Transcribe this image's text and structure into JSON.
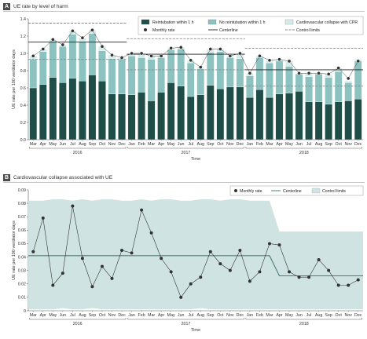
{
  "panels": {
    "a": {
      "letter": "A",
      "title": "UE rate by level of harm"
    },
    "b": {
      "letter": "B",
      "title": "Cardiovascular collapse associated with UE"
    }
  },
  "chart_data": [
    {
      "type": "bar",
      "stacked": true,
      "title": "UE rate by level of harm",
      "xlabel": "Time",
      "ylabel": "UE rate per 100 ventilator days",
      "ylim": [
        0,
        1.4
      ],
      "yticks": [
        0,
        0.2,
        0.4,
        0.6,
        0.8,
        1.0,
        1.2,
        1.4
      ],
      "grid": false,
      "legend_position": "top-right",
      "categories": [
        "Mar",
        "Apr",
        "May",
        "Jun",
        "Jul",
        "Aug",
        "Sep",
        "Oct",
        "Nov",
        "Dec",
        "Jan",
        "Feb",
        "Mar",
        "Apr",
        "May",
        "Jun",
        "Jul",
        "Aug",
        "Sep",
        "Oct",
        "Nov",
        "Dec",
        "Jan",
        "Feb",
        "Mar",
        "Apr",
        "May",
        "Jun",
        "Jul",
        "Aug",
        "Sep",
        "Oct",
        "Nov",
        "Dec"
      ],
      "year_groups": [
        {
          "label": "2016",
          "start": 0,
          "end": 9
        },
        {
          "label": "2017",
          "start": 10,
          "end": 21
        },
        {
          "label": "2018",
          "start": 22,
          "end": 33
        }
      ],
      "series": [
        {
          "name": "Reintubation within 1 h",
          "color": "#1f4d47",
          "values": [
            0.6,
            0.64,
            0.72,
            0.66,
            0.71,
            0.68,
            0.75,
            0.68,
            0.53,
            0.53,
            0.52,
            0.55,
            0.45,
            0.55,
            0.66,
            0.62,
            0.5,
            0.52,
            0.63,
            0.59,
            0.61,
            0.61,
            0.49,
            0.58,
            0.49,
            0.53,
            0.54,
            0.56,
            0.44,
            0.44,
            0.41,
            0.44,
            0.45,
            0.47
          ]
        },
        {
          "name": "No reintubation within 1 h",
          "color": "#8cc3c1",
          "values": [
            0.33,
            0.38,
            0.42,
            0.42,
            0.51,
            0.46,
            0.48,
            0.35,
            0.41,
            0.4,
            0.45,
            0.4,
            0.48,
            0.4,
            0.38,
            0.43,
            0.39,
            0.3,
            0.38,
            0.43,
            0.34,
            0.33,
            0.25,
            0.37,
            0.4,
            0.38,
            0.31,
            0.2,
            0.29,
            0.32,
            0.31,
            0.35,
            0.21,
            0.44
          ]
        },
        {
          "name": "Cardiovascular collapse with CPR",
          "color": "#d7ebeb",
          "values": [
            0.04,
            0.03,
            0.02,
            0.02,
            0.04,
            0.04,
            0.04,
            0.05,
            0.04,
            0.02,
            0.03,
            0.05,
            0.04,
            0.02,
            0.02,
            0.02,
            0.03,
            0.02,
            0.04,
            0.03,
            0.02,
            0.06,
            0.03,
            0.02,
            0.03,
            0.02,
            0.06,
            0.01,
            0.04,
            0.01,
            0.04,
            0.04,
            0.02,
            0.02
          ]
        }
      ],
      "monthly_rate": {
        "name": "Monthly rate",
        "color": "#222222",
        "values": [
          0.97,
          1.05,
          1.16,
          1.1,
          1.26,
          1.18,
          1.27,
          1.08,
          0.98,
          0.95,
          1.0,
          1.0,
          0.97,
          0.97,
          1.06,
          1.07,
          0.92,
          0.84,
          1.05,
          1.05,
          0.97,
          1.0,
          0.77,
          0.97,
          0.92,
          0.93,
          0.91,
          0.77,
          0.77,
          0.77,
          0.76,
          0.83,
          0.71,
          0.91
        ]
      },
      "centerline": {
        "name": "Centerline",
        "color": "#222222",
        "segments": [
          {
            "from": 0,
            "to": 9,
            "value": 1.13
          },
          {
            "from": 10,
            "to": 21,
            "value": 0.99
          },
          {
            "from": 22,
            "to": 33,
            "value": 0.81
          }
        ]
      },
      "control_limits": {
        "name": "Control limits",
        "color": "#888888",
        "segments": [
          {
            "from": 0,
            "to": 9,
            "upper": 1.35,
            "lower": 0.93
          },
          {
            "from": 10,
            "to": 21,
            "upper": 1.17,
            "lower": 0.81
          },
          {
            "from": 22,
            "to": 33,
            "upper": 1.06,
            "lower": 0.62
          }
        ]
      }
    },
    {
      "type": "line",
      "title": "Cardiovascular collapse associated with UE",
      "xlabel": "Time",
      "ylabel": "UE rate per 100 ventilator days",
      "ylim": [
        0,
        0.09
      ],
      "yticks": [
        0,
        0.01,
        0.02,
        0.03,
        0.04,
        0.05,
        0.06,
        0.07,
        0.08,
        0.09
      ],
      "grid": false,
      "legend_position": "top-right",
      "categories": [
        "Mar",
        "Apr",
        "May",
        "Jun",
        "Jul",
        "Aug",
        "Sep",
        "Oct",
        "Nov",
        "Dec",
        "Jan",
        "Feb",
        "Mar",
        "Apr",
        "May",
        "Jun",
        "Jul",
        "Aug",
        "Sep",
        "Oct",
        "Nov",
        "Dec",
        "Jan",
        "Feb",
        "Mar",
        "Apr",
        "May",
        "Jun",
        "Jul",
        "Aug",
        "Sep",
        "Oct",
        "Nov",
        "Dec"
      ],
      "year_groups": [
        {
          "label": "2016",
          "start": 0,
          "end": 9
        },
        {
          "label": "2017",
          "start": 10,
          "end": 21
        },
        {
          "label": "2018",
          "start": 22,
          "end": 33
        }
      ],
      "series": [
        {
          "name": "Monthly rate",
          "color": "#333333",
          "values": [
            0.044,
            0.069,
            0.019,
            0.028,
            0.078,
            0.039,
            0.018,
            0.033,
            0.024,
            0.045,
            0.043,
            0.075,
            0.058,
            0.039,
            0.029,
            0.01,
            0.02,
            0.025,
            0.044,
            0.035,
            0.03,
            0.045,
            0.022,
            0.029,
            0.05,
            0.049,
            0.029,
            0.025,
            0.025,
            0.038,
            0.03,
            0.019,
            0.019,
            0.023
          ]
        }
      ],
      "centerline": {
        "name": "Centerline",
        "color": "#4d7c78",
        "segments": [
          {
            "from": 0,
            "to": 24,
            "value": 0.041
          },
          {
            "from": 25,
            "to": 33,
            "value": 0.026
          }
        ]
      },
      "control_limits": {
        "name": "Control limits",
        "color": "#cfe3e2",
        "upper": [
          0.082,
          0.082,
          0.083,
          0.083,
          0.082,
          0.083,
          0.082,
          0.083,
          0.083,
          0.082,
          0.082,
          0.083,
          0.082,
          0.083,
          0.083,
          0.082,
          0.082,
          0.083,
          0.083,
          0.082,
          0.083,
          0.083,
          0.082,
          0.082,
          0.082,
          0.059,
          0.059,
          0.059,
          0.059,
          0.059,
          0.059,
          0.059,
          0.059,
          0.059
        ],
        "lower": [
          0.001,
          0.001,
          0.001,
          0.002,
          0.001,
          0.001,
          0.002,
          0.001,
          0.001,
          0.001,
          0.001,
          0.001,
          0.001,
          0.001,
          0.001,
          0.001,
          0.001,
          0.002,
          0.001,
          0.001,
          0.001,
          0.001,
          0.001,
          0.001,
          0.001,
          0.001,
          0.001,
          0.001,
          0.001,
          0.001,
          0.001,
          0.001,
          0.001,
          0.001
        ]
      }
    }
  ]
}
